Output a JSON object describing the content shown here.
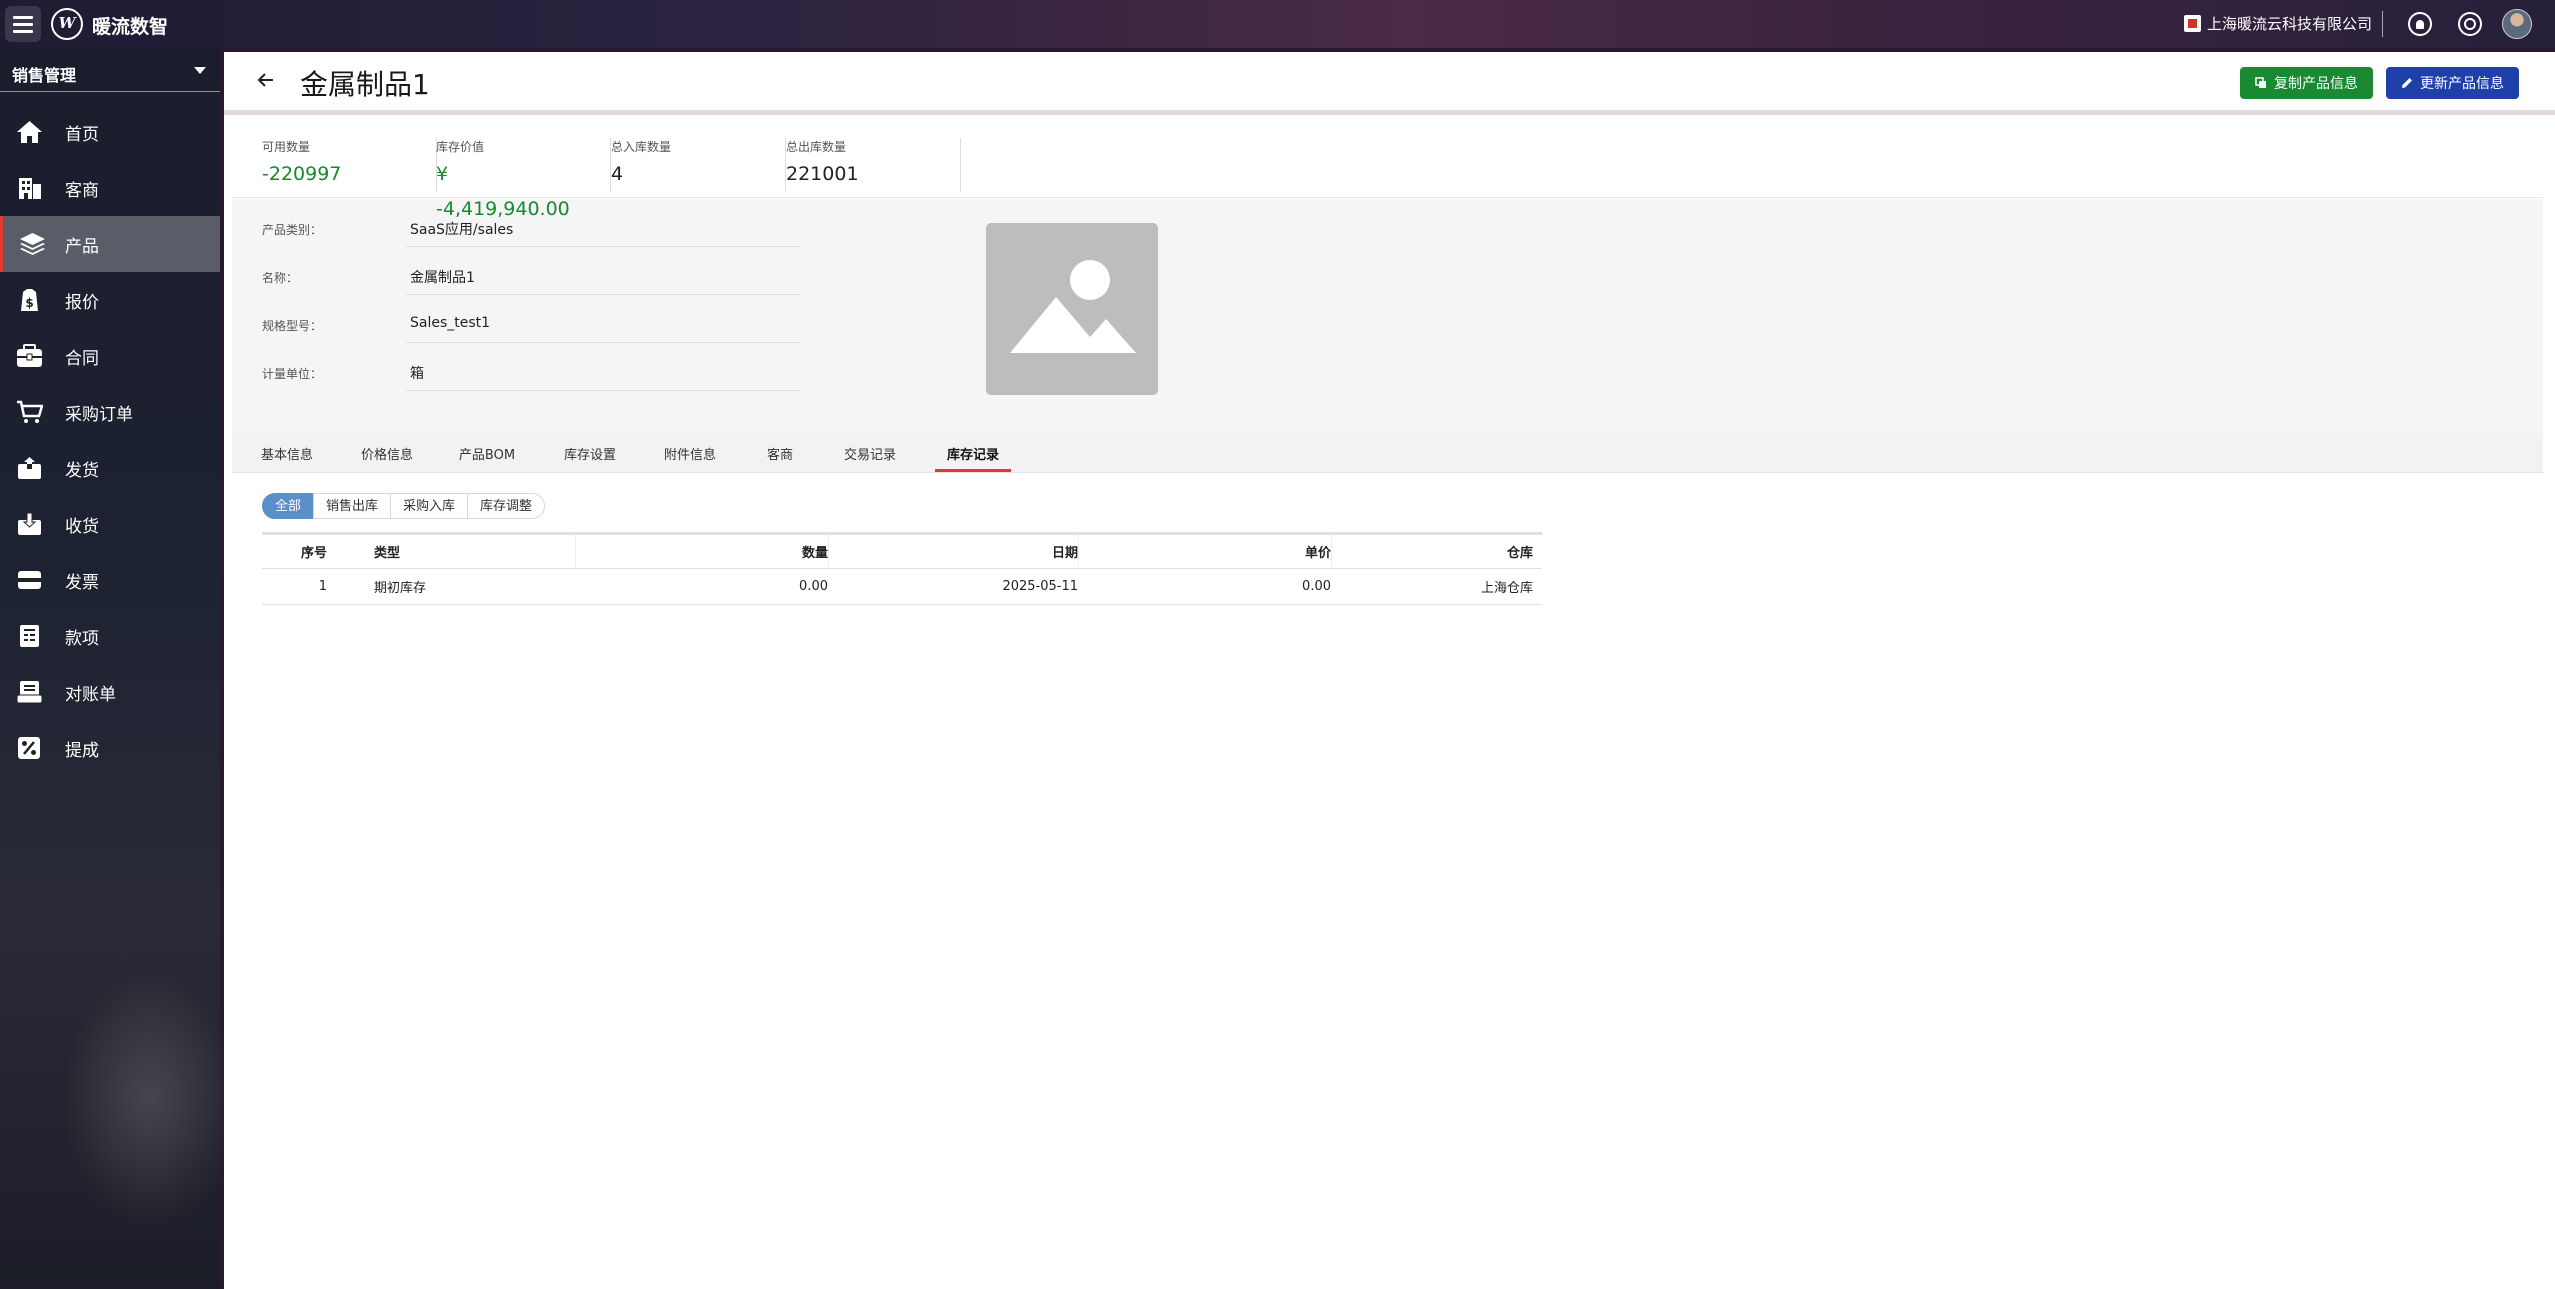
{
  "app": {
    "name": "暖流数智",
    "logo_letter": "W"
  },
  "topbar": {
    "company": "上海暖流云科技有限公司"
  },
  "sidebar": {
    "module": "销售管理",
    "items": [
      {
        "label": "首页",
        "icon": "home-icon"
      },
      {
        "label": "客商",
        "icon": "building-icon"
      },
      {
        "label": "产品",
        "icon": "layers-icon",
        "active": true
      },
      {
        "label": "报价",
        "icon": "quote-icon"
      },
      {
        "label": "合同",
        "icon": "contract-icon"
      },
      {
        "label": "采购订单",
        "icon": "cart-icon"
      },
      {
        "label": "发货",
        "icon": "ship-icon"
      },
      {
        "label": "收货",
        "icon": "receive-icon"
      },
      {
        "label": "发票",
        "icon": "invoice-icon"
      },
      {
        "label": "款项",
        "icon": "payment-icon"
      },
      {
        "label": "对账单",
        "icon": "statement-icon"
      },
      {
        "label": "提成",
        "icon": "percent-icon"
      }
    ]
  },
  "header": {
    "title": "金属制品1",
    "copy_button": "复制产品信息",
    "update_button": "更新产品信息"
  },
  "stats": [
    {
      "label": "可用数量",
      "value": "-220997",
      "color": "#178a2c"
    },
    {
      "label": "库存价值",
      "value": "¥",
      "extra": "-4,419,940.00",
      "color": "#178a2c"
    },
    {
      "label": "总入库数量",
      "value": "4"
    },
    {
      "label": "总出库数量",
      "value": "221001"
    }
  ],
  "info": {
    "category": {
      "label": "产品类别：",
      "value": "SaaS应用/sales"
    },
    "name": {
      "label": "名称：",
      "value": "金属制品1"
    },
    "spec": {
      "label": "规格型号：",
      "value": "Sales_test1"
    },
    "unit": {
      "label": "计量单位：",
      "value": "箱"
    }
  },
  "tabs": [
    "基本信息",
    "价格信息",
    "产品BOM",
    "库存设置",
    "附件信息",
    "客商",
    "交易记录",
    "库存记录"
  ],
  "active_tab": "库存记录",
  "filters": [
    "全部",
    "销售出库",
    "采购入库",
    "库存调整"
  ],
  "active_filter": "全部",
  "table": {
    "headers": {
      "no": "序号",
      "type": "类型",
      "qty": "数量",
      "date": "日期",
      "price": "单价",
      "warehouse": "仓库"
    },
    "rows": [
      {
        "no": "1",
        "type": "期初库存",
        "qty": "0.00",
        "date": "2025-05-11",
        "price": "0.00",
        "warehouse": "上海仓库"
      }
    ]
  }
}
